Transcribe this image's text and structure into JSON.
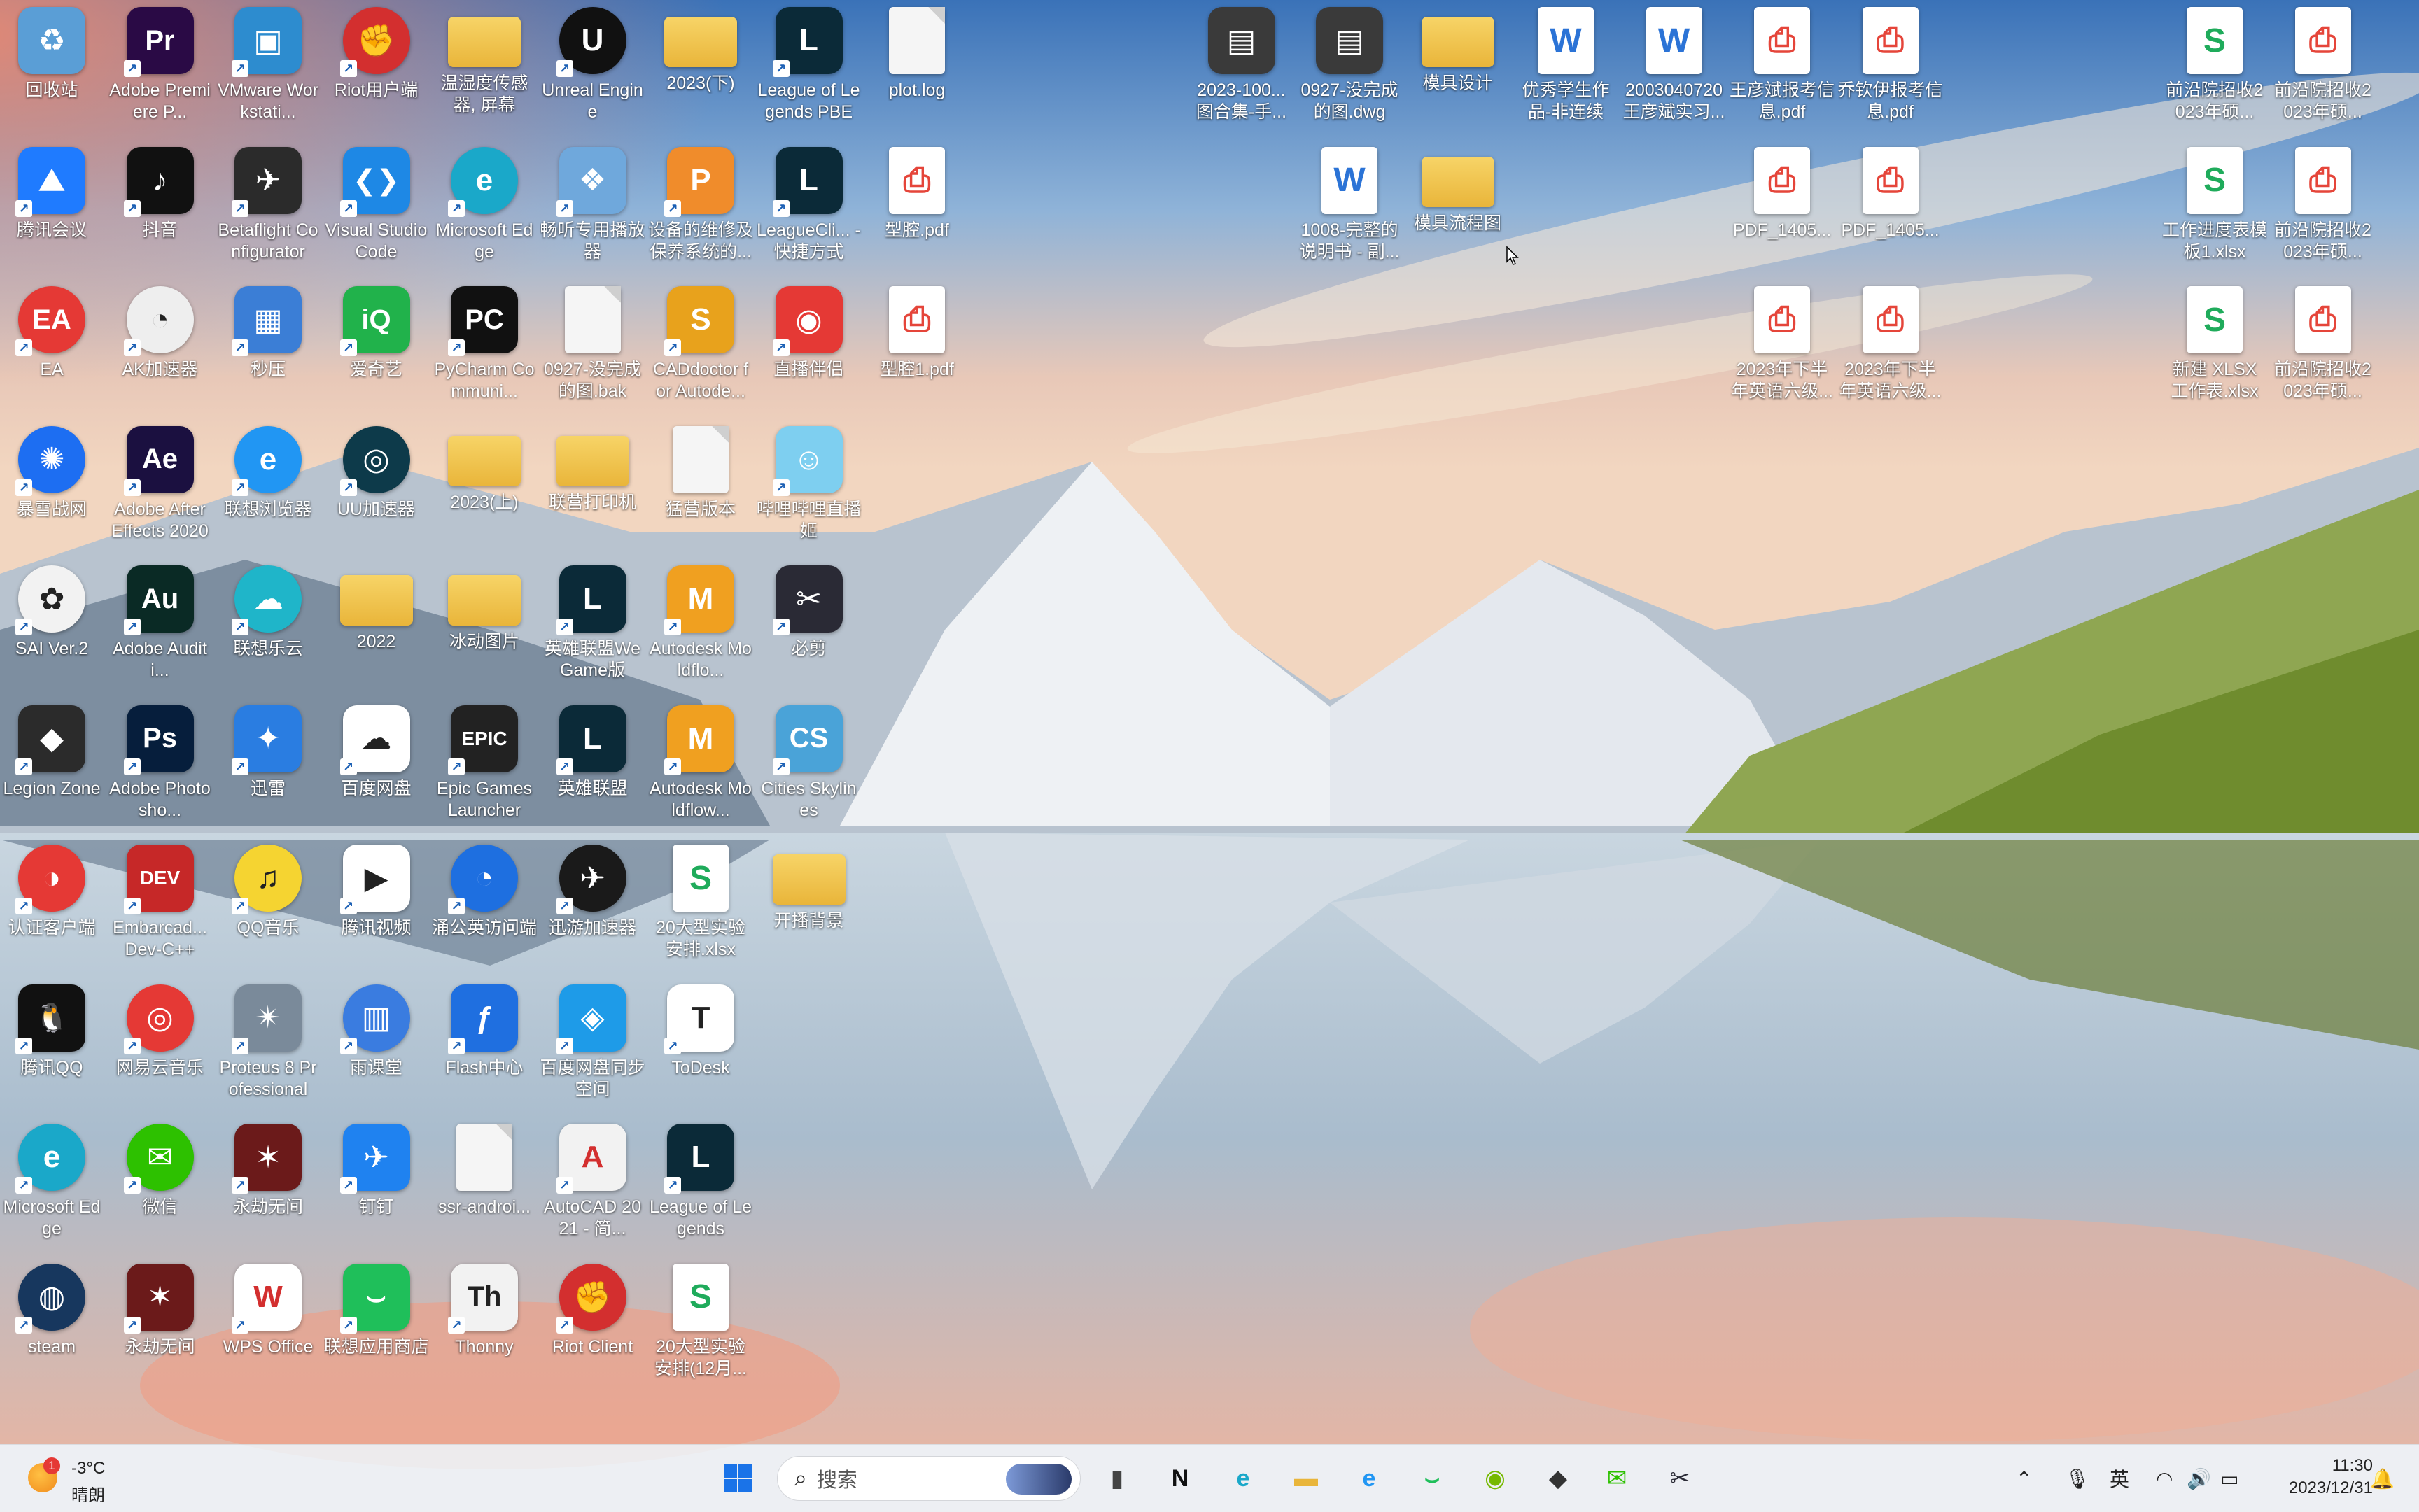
{
  "desktop": {
    "icons": [
      {
        "label": "回收站",
        "col": 0,
        "row": 0,
        "kind": "app",
        "color": "#5a9ed6",
        "glyph": "♻",
        "shortcut": false
      },
      {
        "label": "Adobe Premiere P...",
        "col": 1,
        "row": 0,
        "kind": "app",
        "color": "#2a0a45",
        "glyph": "Pr",
        "shortcut": true
      },
      {
        "label": "VMware Workstati...",
        "col": 2,
        "row": 0,
        "kind": "app",
        "color": "#2d8ccf",
        "glyph": "▣",
        "shortcut": true
      },
      {
        "label": "Riot用户端",
        "col": 3,
        "row": 0,
        "kind": "app",
        "color": "#d32f2f",
        "glyph": "✊",
        "shortcut": true,
        "round": true
      },
      {
        "label": "温湿度传感器, 屏幕",
        "col": 4,
        "row": 0,
        "kind": "folder",
        "shortcut": false
      },
      {
        "label": "Unreal Engine",
        "col": 5,
        "row": 0,
        "kind": "app",
        "color": "#111111",
        "glyph": "U",
        "shortcut": true,
        "round": true
      },
      {
        "label": "2023(下)",
        "col": 6,
        "row": 0,
        "kind": "folder",
        "shortcut": false
      },
      {
        "label": "League of Legends PBE",
        "col": 7,
        "row": 0,
        "kind": "app",
        "color": "#0b2a38",
        "glyph": "L",
        "shortcut": true
      },
      {
        "label": "plot.log",
        "col": 8,
        "row": 0,
        "kind": "doc",
        "shortcut": false
      },
      {
        "label": "腾讯会议",
        "col": 0,
        "row": 1,
        "kind": "app",
        "color": "#1f7bff",
        "glyph": "⛰",
        "shortcut": true
      },
      {
        "label": "抖音",
        "col": 1,
        "row": 1,
        "kind": "app",
        "color": "#111111",
        "glyph": "♪",
        "shortcut": true
      },
      {
        "label": "Betaflight Configurator",
        "col": 2,
        "row": 1,
        "kind": "app",
        "color": "#2b2b2b",
        "glyph": "✈",
        "shortcut": true
      },
      {
        "label": "Visual Studio Code",
        "col": 3,
        "row": 1,
        "kind": "app",
        "color": "#1e88e5",
        "glyph": "❮❯",
        "shortcut": true
      },
      {
        "label": "Microsoft Edge",
        "col": 4,
        "row": 1,
        "kind": "app",
        "color": "#1aa8c9",
        "glyph": "e",
        "shortcut": true,
        "round": true
      },
      {
        "label": "畅听专用播放器",
        "col": 5,
        "row": 1,
        "kind": "app",
        "color": "#6fa8dc",
        "glyph": "❖",
        "shortcut": true
      },
      {
        "label": "设备的维修及保养系统的...",
        "col": 6,
        "row": 1,
        "kind": "app",
        "color": "#f08c2b",
        "glyph": "P",
        "shortcut": true
      },
      {
        "label": "LeagueCli... - 快捷方式",
        "col": 7,
        "row": 1,
        "kind": "app",
        "color": "#0b2a38",
        "glyph": "L",
        "shortcut": true
      },
      {
        "label": "型腔.pdf",
        "col": 8,
        "row": 1,
        "kind": "pdf",
        "shortcut": false
      },
      {
        "label": "EA",
        "col": 0,
        "row": 2,
        "kind": "app",
        "color": "#e53935",
        "glyph": "EA",
        "shortcut": true,
        "round": true
      },
      {
        "label": "AK加速器",
        "col": 1,
        "row": 2,
        "kind": "app",
        "color": "#eeeeee",
        "glyph": "◔",
        "shortcut": true,
        "round": true,
        "dark": true
      },
      {
        "label": "秒压",
        "col": 2,
        "row": 2,
        "kind": "app",
        "color": "#3b7ed6",
        "glyph": "▦",
        "shortcut": true
      },
      {
        "label": "爱奇艺",
        "col": 3,
        "row": 2,
        "kind": "app",
        "color": "#21b24b",
        "glyph": "iQ",
        "shortcut": true
      },
      {
        "label": "PyCharm Communi...",
        "col": 4,
        "row": 2,
        "kind": "app",
        "color": "#111111",
        "glyph": "PC",
        "shortcut": true
      },
      {
        "label": "0927-没完成的图.bak",
        "col": 5,
        "row": 2,
        "kind": "doc",
        "shortcut": false
      },
      {
        "label": "CADdoctor for Autode...",
        "col": 6,
        "row": 2,
        "kind": "app",
        "color": "#e8a21c",
        "glyph": "S",
        "shortcut": true
      },
      {
        "label": "直播伴侣",
        "col": 7,
        "row": 2,
        "kind": "app",
        "color": "#e53935",
        "glyph": "◉",
        "shortcut": true
      },
      {
        "label": "型腔1.pdf",
        "col": 8,
        "row": 2,
        "kind": "pdf",
        "shortcut": false
      },
      {
        "label": "暴雪战网",
        "col": 0,
        "row": 3,
        "kind": "app",
        "color": "#1d6ef2",
        "glyph": "✺",
        "shortcut": true,
        "round": true
      },
      {
        "label": "Adobe After Effects 2020",
        "col": 1,
        "row": 3,
        "kind": "app",
        "color": "#1b1040",
        "glyph": "Ae",
        "shortcut": true
      },
      {
        "label": "联想浏览器",
        "col": 2,
        "row": 3,
        "kind": "app",
        "color": "#2196f3",
        "glyph": "e",
        "shortcut": true,
        "round": true
      },
      {
        "label": "UU加速器",
        "col": 3,
        "row": 3,
        "kind": "app",
        "color": "#0d3a4a",
        "glyph": "◎",
        "shortcut": true,
        "round": true
      },
      {
        "label": "2023(上)",
        "col": 4,
        "row": 3,
        "kind": "folder",
        "shortcut": false
      },
      {
        "label": "联营打印机",
        "col": 5,
        "row": 3,
        "kind": "folder",
        "shortcut": false
      },
      {
        "label": "猛营版本",
        "col": 6,
        "row": 3,
        "kind": "doc",
        "shortcut": false
      },
      {
        "label": "哔哩哔哩直播姬",
        "col": 7,
        "row": 3,
        "kind": "app",
        "color": "#7ecff0",
        "glyph": "☺",
        "shortcut": true
      },
      {
        "label": "SAI Ver.2",
        "col": 0,
        "row": 4,
        "kind": "app",
        "color": "#f2f2f2",
        "glyph": "✿",
        "shortcut": true,
        "round": true,
        "dark": true
      },
      {
        "label": "Adobe Auditi...",
        "col": 1,
        "row": 4,
        "kind": "app",
        "color": "#0a2a25",
        "glyph": "Au",
        "shortcut": true
      },
      {
        "label": "联想乐云",
        "col": 2,
        "row": 4,
        "kind": "app",
        "color": "#1fb5c9",
        "glyph": "☁",
        "shortcut": true,
        "round": true
      },
      {
        "label": "2022",
        "col": 3,
        "row": 4,
        "kind": "folder",
        "shortcut": false
      },
      {
        "label": "冰动图片",
        "col": 4,
        "row": 4,
        "kind": "folder",
        "shortcut": false
      },
      {
        "label": "英雄联盟WeGame版",
        "col": 5,
        "row": 4,
        "kind": "app",
        "color": "#0b2a38",
        "glyph": "L",
        "shortcut": true
      },
      {
        "label": "Autodesk Moldflo...",
        "col": 6,
        "row": 4,
        "kind": "app",
        "color": "#f0a020",
        "glyph": "M",
        "shortcut": true
      },
      {
        "label": "必剪",
        "col": 7,
        "row": 4,
        "kind": "app",
        "color": "#2a2a35",
        "glyph": "✂",
        "shortcut": true
      },
      {
        "label": "Legion Zone",
        "col": 0,
        "row": 5,
        "kind": "app",
        "color": "#2b2b2b",
        "glyph": "◆",
        "shortcut": true
      },
      {
        "label": "Adobe Photosho...",
        "col": 1,
        "row": 5,
        "kind": "app",
        "color": "#061e3c",
        "glyph": "Ps",
        "shortcut": true
      },
      {
        "label": "迅雷",
        "col": 2,
        "row": 5,
        "kind": "app",
        "color": "#2a7de1",
        "glyph": "✦",
        "shortcut": true
      },
      {
        "label": "百度网盘",
        "col": 3,
        "row": 5,
        "kind": "app",
        "color": "#ffffff",
        "glyph": "☁",
        "shortcut": true,
        "dark": true
      },
      {
        "label": "Epic Games Launcher",
        "col": 4,
        "row": 5,
        "kind": "app",
        "color": "#222222",
        "glyph": "EPIC",
        "shortcut": true
      },
      {
        "label": "英雄联盟",
        "col": 5,
        "row": 5,
        "kind": "app",
        "color": "#0b2a38",
        "glyph": "L",
        "shortcut": true
      },
      {
        "label": "Autodesk Moldflow...",
        "col": 6,
        "row": 5,
        "kind": "app",
        "color": "#f0a020",
        "glyph": "M",
        "shortcut": true
      },
      {
        "label": "Cities Skylines",
        "col": 7,
        "row": 5,
        "kind": "app",
        "color": "#4aa3d8",
        "glyph": "CS",
        "shortcut": true
      },
      {
        "label": "认证客户端",
        "col": 0,
        "row": 6,
        "kind": "app",
        "color": "#e53935",
        "glyph": "◑",
        "shortcut": true,
        "round": true
      },
      {
        "label": "Embarcad... Dev-C++",
        "col": 1,
        "row": 6,
        "kind": "app",
        "color": "#c62828",
        "glyph": "DEV",
        "shortcut": true
      },
      {
        "label": "QQ音乐",
        "col": 2,
        "row": 6,
        "kind": "app",
        "color": "#f5d431",
        "glyph": "♫",
        "shortcut": true,
        "round": true,
        "dark": true
      },
      {
        "label": "腾讯视频",
        "col": 3,
        "row": 6,
        "kind": "app",
        "color": "#ffffff",
        "glyph": "▶",
        "shortcut": true,
        "dark": true
      },
      {
        "label": "涌公英访问端",
        "col": 4,
        "row": 6,
        "kind": "app",
        "color": "#1e6fe0",
        "glyph": "◔",
        "shortcut": true,
        "round": true
      },
      {
        "label": "迅游加速器",
        "col": 5,
        "row": 6,
        "kind": "app",
        "color": "#1a1a1a",
        "glyph": "✈",
        "shortcut": true,
        "round": true
      },
      {
        "label": "20大型实验安排.xlsx",
        "col": 6,
        "row": 6,
        "kind": "xls",
        "shortcut": false
      },
      {
        "label": "开播背景",
        "col": 7,
        "row": 6,
        "kind": "folder",
        "shortcut": false
      },
      {
        "label": "腾讯QQ",
        "col": 0,
        "row": 7,
        "kind": "app",
        "color": "#111111",
        "glyph": "🐧",
        "shortcut": true
      },
      {
        "label": "网易云音乐",
        "col": 1,
        "row": 7,
        "kind": "app",
        "color": "#e53935",
        "glyph": "◎",
        "shortcut": true,
        "round": true
      },
      {
        "label": "Proteus 8 Professional",
        "col": 2,
        "row": 7,
        "kind": "app",
        "color": "#7a8a9a",
        "glyph": "✴",
        "shortcut": true
      },
      {
        "label": "雨课堂",
        "col": 3,
        "row": 7,
        "kind": "app",
        "color": "#3a7ce0",
        "glyph": "▥",
        "shortcut": true,
        "round": true
      },
      {
        "label": "Flash中心",
        "col": 4,
        "row": 7,
        "kind": "app",
        "color": "#1f6fe0",
        "glyph": "ƒ",
        "shortcut": true
      },
      {
        "label": "百度网盘同步空间",
        "col": 5,
        "row": 7,
        "kind": "app",
        "color": "#1e9be8",
        "glyph": "◈",
        "shortcut": true
      },
      {
        "label": "ToDesk",
        "col": 6,
        "row": 7,
        "kind": "app",
        "color": "#ffffff",
        "glyph": "T",
        "shortcut": true,
        "dark": true
      },
      {
        "label": "Microsoft Edge",
        "col": 0,
        "row": 8,
        "kind": "app",
        "color": "#1aa8c9",
        "glyph": "e",
        "shortcut": true,
        "round": true
      },
      {
        "label": "微信",
        "col": 1,
        "row": 8,
        "kind": "app",
        "color": "#2dc100",
        "glyph": "✉",
        "shortcut": true,
        "round": true
      },
      {
        "label": "永劫无间",
        "col": 2,
        "row": 8,
        "kind": "app",
        "color": "#6b1a1a",
        "glyph": "✶",
        "shortcut": true
      },
      {
        "label": "钉钉",
        "col": 3,
        "row": 8,
        "kind": "app",
        "color": "#1f82f0",
        "glyph": "✈",
        "shortcut": true
      },
      {
        "label": "ssr-androi...",
        "col": 4,
        "row": 8,
        "kind": "doc",
        "shortcut": false
      },
      {
        "label": "AutoCAD 2021 - 简...",
        "col": 5,
        "row": 8,
        "kind": "app",
        "color": "#f2f2f2",
        "glyph": "A",
        "shortcut": true,
        "dark": true,
        "red": true
      },
      {
        "label": "League of Legends",
        "col": 6,
        "row": 8,
        "kind": "app",
        "color": "#0b2a38",
        "glyph": "L",
        "shortcut": true
      },
      {
        "label": "steam",
        "col": 0,
        "row": 9,
        "kind": "app",
        "color": "#17375e",
        "glyph": "◍",
        "shortcut": true,
        "round": true
      },
      {
        "label": "永劫无间",
        "col": 1,
        "row": 9,
        "kind": "app",
        "color": "#6b1a1a",
        "glyph": "✶",
        "shortcut": true
      },
      {
        "label": "WPS Office",
        "col": 2,
        "row": 9,
        "kind": "app",
        "color": "#ffffff",
        "glyph": "W",
        "shortcut": true,
        "dark": true,
        "red": true
      },
      {
        "label": "联想应用商店",
        "col": 3,
        "row": 9,
        "kind": "app",
        "color": "#1fbf5a",
        "glyph": "⌣",
        "shortcut": true
      },
      {
        "label": "Thonny",
        "col": 4,
        "row": 9,
        "kind": "app",
        "color": "#f2f2f2",
        "glyph": "Th",
        "shortcut": true,
        "dark": true
      },
      {
        "label": "Riot Client",
        "col": 5,
        "row": 9,
        "kind": "app",
        "color": "#d32f2f",
        "glyph": "✊",
        "shortcut": true,
        "round": true
      },
      {
        "label": "20大型实验安排(12月...",
        "col": 6,
        "row": 9,
        "kind": "xls",
        "shortcut": false
      },
      {
        "label": "2023-100... 图合集-手...",
        "col": 11,
        "row": 0,
        "kind": "app",
        "color": "#3a3a3a",
        "glyph": "▤",
        "shortcut": false
      },
      {
        "label": "0927-没完成的图.dwg",
        "col": 12,
        "row": 0,
        "kind": "app",
        "color": "#3a3a3a",
        "glyph": "▤",
        "shortcut": false
      },
      {
        "label": "模具设计",
        "col": 13,
        "row": 0,
        "kind": "folder",
        "shortcut": false
      },
      {
        "label": "优秀学生作品-非连续内...",
        "col": 14,
        "row": 0,
        "kind": "wrd",
        "shortcut": false
      },
      {
        "label": "2003040720王彦斌实习...",
        "col": 15,
        "row": 0,
        "kind": "wrd",
        "shortcut": false
      },
      {
        "label": "王彦斌报考信息.pdf",
        "col": 16,
        "row": 0,
        "kind": "pdf",
        "shortcut": false
      },
      {
        "label": "乔钦伊报考信息.pdf",
        "col": 17,
        "row": 0,
        "kind": "pdf",
        "shortcut": false
      },
      {
        "label": "前沿院招收2023年硕...",
        "col": 20,
        "row": 0,
        "kind": "xls",
        "shortcut": false
      },
      {
        "label": "前沿院招收2023年硕...",
        "col": 21,
        "row": 0,
        "kind": "pdf",
        "shortcut": false
      },
      {
        "label": "1008-完整的说明书 - 副...",
        "col": 12,
        "row": 1,
        "kind": "wrd",
        "shortcut": false
      },
      {
        "label": "模具流程图",
        "col": 13,
        "row": 1,
        "kind": "folder",
        "shortcut": false
      },
      {
        "label": "PDF_1405...",
        "col": 16,
        "row": 1,
        "kind": "pdf",
        "shortcut": false
      },
      {
        "label": "PDF_1405...",
        "col": 17,
        "row": 1,
        "kind": "pdf",
        "shortcut": false
      },
      {
        "label": "工作进度表模板1.xlsx",
        "col": 20,
        "row": 1,
        "kind": "xls",
        "shortcut": false
      },
      {
        "label": "前沿院招收2023年硕...",
        "col": 21,
        "row": 1,
        "kind": "pdf",
        "shortcut": false
      },
      {
        "label": "2023年下半年英语六级...",
        "col": 16,
        "row": 2,
        "kind": "pdf",
        "shortcut": false
      },
      {
        "label": "2023年下半年英语六级...",
        "col": 17,
        "row": 2,
        "kind": "pdf",
        "shortcut": false
      },
      {
        "label": "新建 XLSX 工作表.xlsx",
        "col": 20,
        "row": 2,
        "kind": "xls",
        "shortcut": false
      },
      {
        "label": "前沿院招收2023年硕...",
        "col": 21,
        "row": 2,
        "kind": "pdf",
        "shortcut": false
      }
    ]
  },
  "taskbar": {
    "weather": {
      "temp": "-3°C",
      "condition": "晴朗",
      "badge": "1"
    },
    "search_placeholder": "搜索",
    "pinned": [
      {
        "name": "start",
        "glyph": "⊞",
        "color": "#1a73e8"
      },
      {
        "name": "task-view",
        "glyph": "▮",
        "color": "#444444"
      },
      {
        "name": "notion",
        "glyph": "N",
        "color": "#111111"
      },
      {
        "name": "edge",
        "glyph": "e",
        "color": "#1aa8c9"
      },
      {
        "name": "file-explorer",
        "glyph": "▬",
        "color": "#e9b53a"
      },
      {
        "name": "lenovo-browser",
        "glyph": "e",
        "color": "#2196f3"
      },
      {
        "name": "lenovo-store",
        "glyph": "⌣",
        "color": "#1fbf5a"
      },
      {
        "name": "nvidia",
        "glyph": "◉",
        "color": "#76b900"
      },
      {
        "name": "legion-zone",
        "glyph": "◆",
        "color": "#333333"
      },
      {
        "name": "wechat",
        "glyph": "✉",
        "color": "#2dc100"
      },
      {
        "name": "bijian",
        "glyph": "✂",
        "color": "#2a2a35"
      }
    ],
    "tray": {
      "ime": "英",
      "time": "11:30",
      "date": "2023/12/31"
    }
  }
}
